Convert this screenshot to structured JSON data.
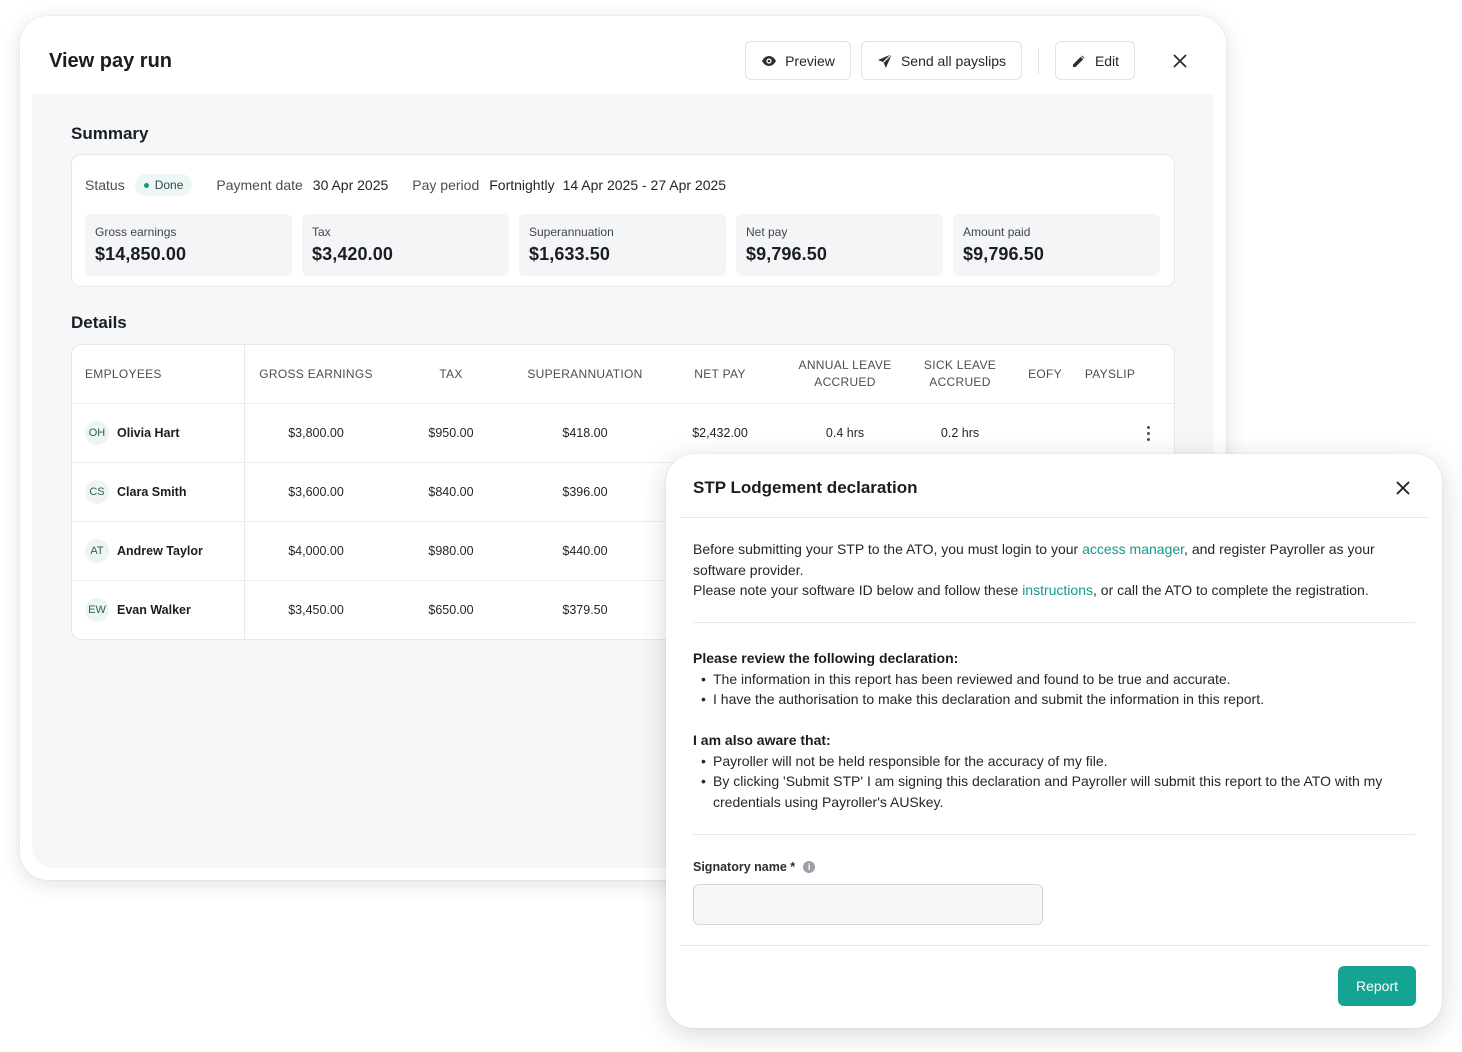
{
  "window": {
    "title": "View pay run",
    "preview_label": "Preview",
    "send_label": "Send all payslips",
    "edit_label": "Edit"
  },
  "summary": {
    "title": "Summary",
    "status_label": "Status",
    "status_value": "Done",
    "payment_date_label": "Payment date",
    "payment_date_value": "30 Apr 2025",
    "pay_period_label": "Pay period",
    "pay_period_frequency": "Fortnightly",
    "pay_period_range": "14 Apr 2025 - 27 Apr 2025",
    "stats": [
      {
        "label": "Gross earnings",
        "value": "$14,850.00"
      },
      {
        "label": "Tax",
        "value": "$3,420.00"
      },
      {
        "label": "Superannuation",
        "value": "$1,633.50"
      },
      {
        "label": "Net pay",
        "value": "$9,796.50"
      },
      {
        "label": "Amount paid",
        "value": "$9,796.50"
      }
    ]
  },
  "details": {
    "title": "Details",
    "columns": [
      "EMPLOYEES",
      "GROSS EARNINGS",
      "TAX",
      "SUPERANNUATION",
      "NET PAY",
      "ANNUAL LEAVE ACCRUED",
      "SICK LEAVE ACCRUED",
      "EOFY",
      "PAYSLIP"
    ],
    "rows": [
      {
        "initials": "OH",
        "name": "Olivia Hart",
        "gross": "$3,800.00",
        "tax": "$950.00",
        "super": "$418.00",
        "net": "$2,432.00",
        "annual": "0.4 hrs",
        "sick": "0.2 hrs"
      },
      {
        "initials": "CS",
        "name": "Clara Smith",
        "gross": "$3,600.00",
        "tax": "$840.00",
        "super": "$396.00"
      },
      {
        "initials": "AT",
        "name": "Andrew Taylor",
        "gross": "$4,000.00",
        "tax": "$980.00",
        "super": "$440.00"
      },
      {
        "initials": "EW",
        "name": "Evan Walker",
        "gross": "$3,450.00",
        "tax": "$650.00",
        "super": "$379.50"
      }
    ]
  },
  "modal": {
    "title": "STP Lodgement declaration",
    "intro_1": "Before submitting your STP to the ATO, you must login to your ",
    "access_manager_link": "access manager",
    "intro_2": ", and register Payroller as your software provider.",
    "intro_3": "Please note your software ID below and follow these ",
    "instructions_link": "instructions",
    "intro_4": ", or call the ATO to complete the registration.",
    "review_heading": "Please review the following declaration:",
    "review_items": [
      "The information in this report has been reviewed and found to be true and accurate.",
      "I have the authorisation to make this declaration and submit the information in this report."
    ],
    "aware_heading": "I am also aware that:",
    "aware_items": [
      "Payroller will not be held responsible for the accuracy of my file.",
      "By clicking 'Submit STP' I am signing this declaration and Payroller will submit this report to the ATO with my credentials using Payroller's AUSkey."
    ],
    "signatory_label": "Signatory name *",
    "signatory_value": "",
    "report_label": "Report"
  },
  "colors": {
    "accent": "#15a394",
    "link": "#12998d"
  }
}
